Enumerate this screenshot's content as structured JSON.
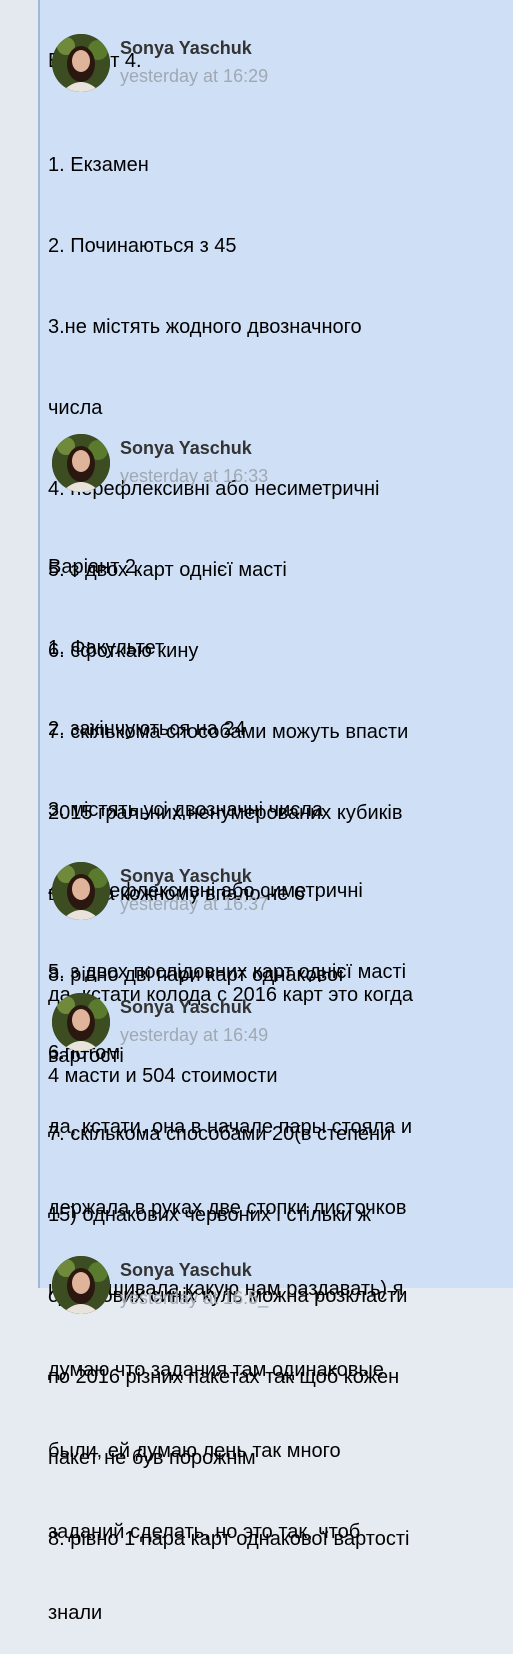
{
  "messages": [
    {
      "lines": [
        "Варіант 4."
      ]
    },
    {
      "author": "Sonya Yaschuk",
      "time": "yesterday at 16:29",
      "lines": [
        "1. Екзамен",
        "2. Починаються з 45",
        "3.не містять жодного двозначного",
        "числа",
        "4. нерефлексивні або несиметричні",
        "5. з двох карт однієї масті",
        "6. сфоткаю кину",
        "7. скількома способами можуть впасти",
        "2015 гральних ненумерованих кубиків",
        "щоб на кожному впало не 6",
        "8. рівно дві пари карт однакової",
        "вартості"
      ]
    },
    {
      "author": "Sonya Yaschuk",
      "time": "yesterday at 16:33",
      "lines": [
        "Варіант 2.",
        "1. Факультет",
        "2. закінчуються на 24",
        "3. містять усі двозначні числа",
        "4. не рефлексивні або симетричні",
        "5. з двох послідовних карт однієї масті",
        "6.потом",
        "7. скількома способами 20(в степени",
        "15) однакових червоних і стільки ж",
        "однакових синіх куль можна розкласти",
        "по 2016 різних пакетах так щоб кожен",
        "пакет не був порожнім",
        "8. рівно 1 пара карт однакової вартості"
      ]
    },
    {
      "author": "Sonya Yaschuk",
      "time": "yesterday at 16:37",
      "lines": [
        "да, кстати колода с 2016 карт это когда",
        "4 масти и 504 стоимости"
      ]
    },
    {
      "author": "Sonya Yaschuk",
      "time": "yesterday at 16:49",
      "lines": [
        "да, кстати, она в начале пары стояла и",
        "держала в руках две стопки листочков",
        "и спрашивала какую нам раздавать) я",
        "думаю что задания там одинаковые",
        "были, ей думаю лень так много",
        "заданий сделать, но это так, чтоб",
        "знали"
      ]
    },
    {
      "author": "Sonya Yaschuk",
      "time": "yesterday at 16:5_"
    }
  ]
}
